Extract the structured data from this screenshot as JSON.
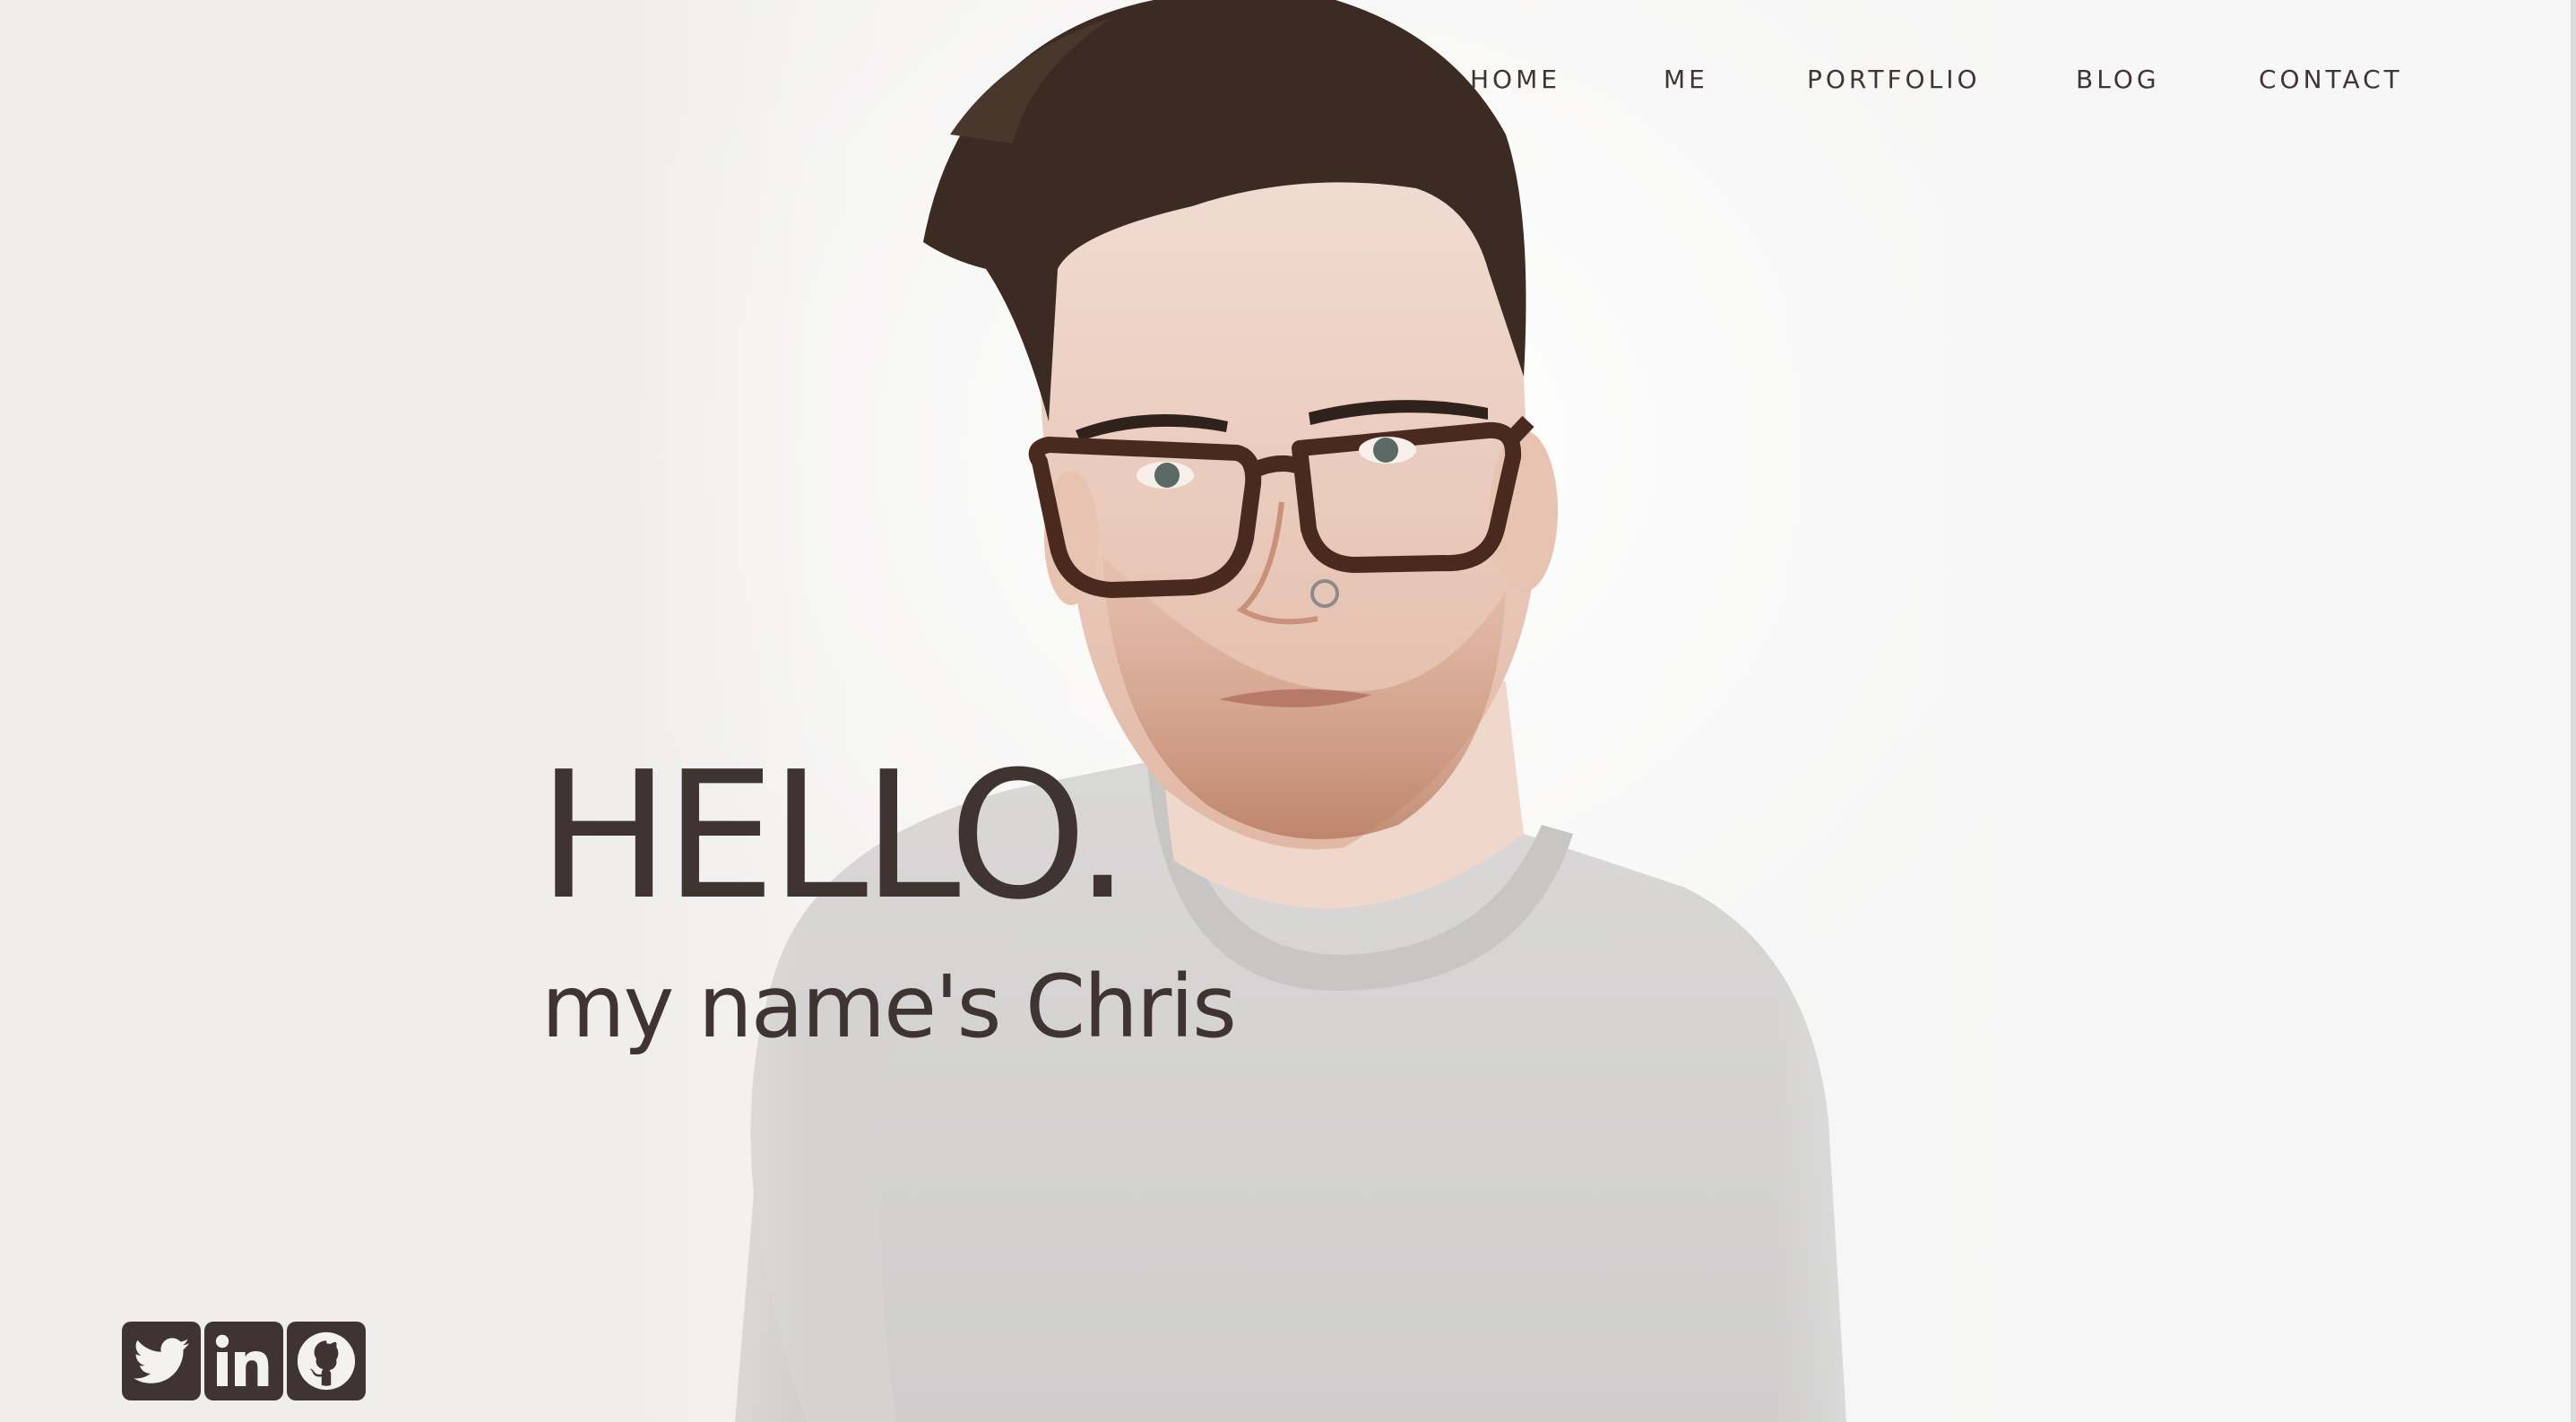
{
  "nav": {
    "items": [
      {
        "label": "HOME"
      },
      {
        "label": "ME"
      },
      {
        "label": "PORTFOLIO"
      },
      {
        "label": "BLOG"
      },
      {
        "label": "CONTACT"
      }
    ]
  },
  "hero": {
    "greeting": "HELLO.",
    "subtitle": "my name's Chris"
  },
  "social": {
    "icons": [
      "twitter-icon",
      "linkedin-icon",
      "github-icon"
    ]
  },
  "colors": {
    "text": "#3f3432",
    "background": "#f3f2f1"
  }
}
